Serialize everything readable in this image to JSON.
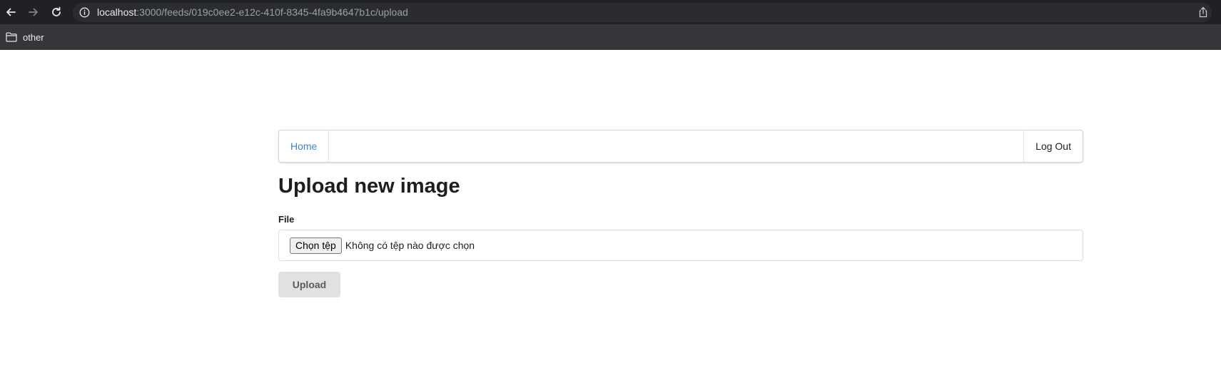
{
  "browser": {
    "url_host": "localhost",
    "url_rest": ":3000/feeds/019c0ee2-e12c-410f-8345-4fa9b4647b1c/upload",
    "bookmarks": [
      {
        "label": "other",
        "icon": "folder-icon"
      }
    ]
  },
  "nav": {
    "home_label": "Home",
    "logout_label": "Log Out"
  },
  "main": {
    "title": "Upload new image",
    "file_label": "File",
    "file_choose_label": "Chọn tệp",
    "file_status": "Không có tệp nào được chọn",
    "upload_label": "Upload"
  },
  "colors": {
    "chrome_dark": "#202124",
    "bookmarks_bar": "#35363a",
    "link_blue": "#4183c4",
    "button_gray": "#e0e1e2"
  }
}
